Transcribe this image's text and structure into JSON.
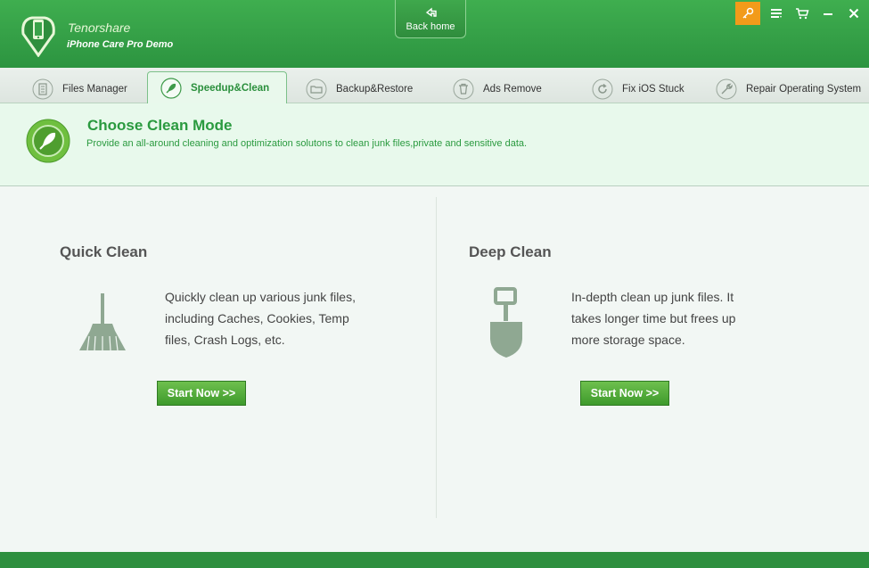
{
  "app": {
    "brand_name": "Tenorshare",
    "product_name": "iPhone Care Pro Demo",
    "back_home_label": "Back home",
    "accent_color": "#2e9a42",
    "key_button_color": "#f29b1a"
  },
  "tabs": [
    {
      "label": "Files Manager",
      "icon": "document-icon",
      "active": false
    },
    {
      "label": "Speedup&Clean",
      "icon": "rocket-icon",
      "active": true
    },
    {
      "label": "Backup&Restore",
      "icon": "folder-icon",
      "active": false
    },
    {
      "label": "Ads Remove",
      "icon": "trash-icon",
      "active": false
    },
    {
      "label": "Fix iOS Stuck",
      "icon": "refresh-icon",
      "active": false
    },
    {
      "label": "Repair Operating System",
      "icon": "wrench-icon",
      "active": false
    }
  ],
  "header": {
    "title": "Choose Clean Mode",
    "description": "Provide an all-around cleaning and optimization solutons to clean junk files,private and sensitive data."
  },
  "quick_clean": {
    "title": "Quick Clean",
    "description": "Quickly clean up various junk files, including Caches, Cookies, Temp files, Crash Logs, etc.",
    "button_label": "Start Now >>",
    "icon": "broom-icon"
  },
  "deep_clean": {
    "title": "Deep Clean",
    "description": "In-depth clean up junk files. It takes longer time but frees up more storage space.",
    "button_label": "Start Now >>",
    "icon": "shovel-icon"
  }
}
